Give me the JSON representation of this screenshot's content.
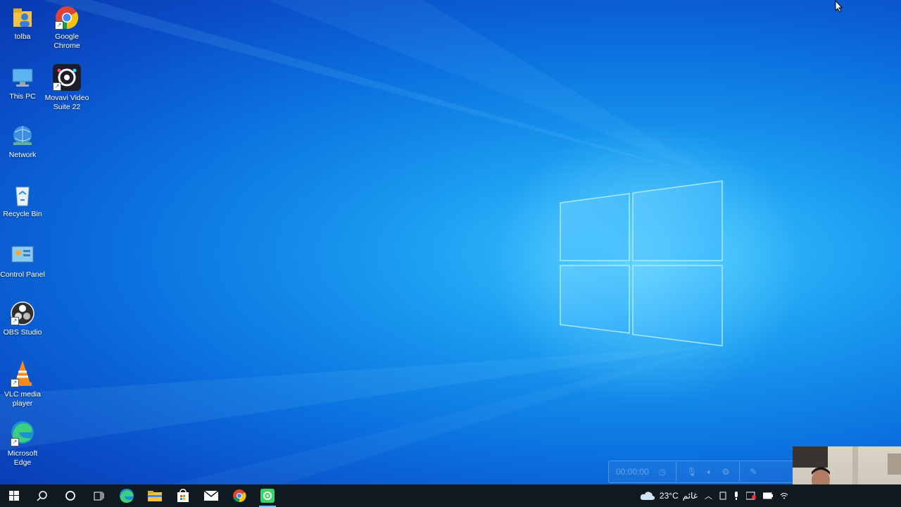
{
  "desktop": {
    "icons": [
      {
        "label": "tolba",
        "icon": "user-folder-icon"
      },
      {
        "label": "Google Chrome",
        "icon": "chrome-icon"
      },
      {
        "label": "This PC",
        "icon": "computer-icon"
      },
      {
        "label": "Movavi Video Suite 22",
        "icon": "movavi-icon"
      },
      {
        "label": "Network",
        "icon": "network-icon"
      },
      {
        "label": "Recycle Bin",
        "icon": "recycle-bin-icon"
      },
      {
        "label": "Control Panel",
        "icon": "control-panel-icon"
      },
      {
        "label": "OBS Studio",
        "icon": "obs-icon"
      },
      {
        "label": "VLC media player",
        "icon": "vlc-icon"
      },
      {
        "label": "Microsoft Edge",
        "icon": "edge-icon"
      }
    ]
  },
  "recorder": {
    "timer": "00:00:00"
  },
  "taskbar": {
    "buttons": [
      "start-icon",
      "search-icon",
      "cortana-icon",
      "task-view-icon",
      "edge-icon",
      "file-explorer-icon",
      "store-icon",
      "mail-icon",
      "chrome-icon",
      "movavi-icon"
    ],
    "weather": {
      "temp": "23°C",
      "condition": "غائم",
      "icon": "cloud-icon"
    }
  },
  "colors": {
    "taskbar_bg": "#101820",
    "accent": "#76b9ed"
  }
}
